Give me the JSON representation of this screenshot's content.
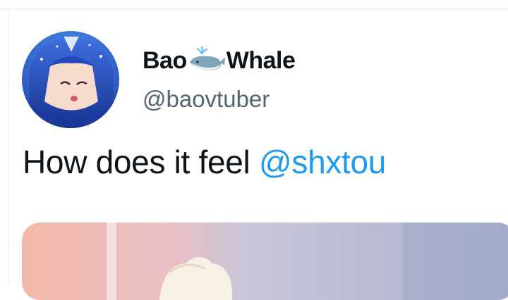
{
  "tweet": {
    "author": {
      "name_before": "Bao",
      "name_after": "Whale",
      "name_emoji": "whale-emoji",
      "handle": "@baovtuber",
      "avatar_icon": "avatar-vtuber-blue-hair"
    },
    "text": "How does it feel ",
    "mention": "@shxtou",
    "media_icon": "attached-image"
  },
  "colors": {
    "text": "#0f1419",
    "secondary": "#536471",
    "link": "#1d9bf0",
    "border": "#e6e6e6"
  }
}
